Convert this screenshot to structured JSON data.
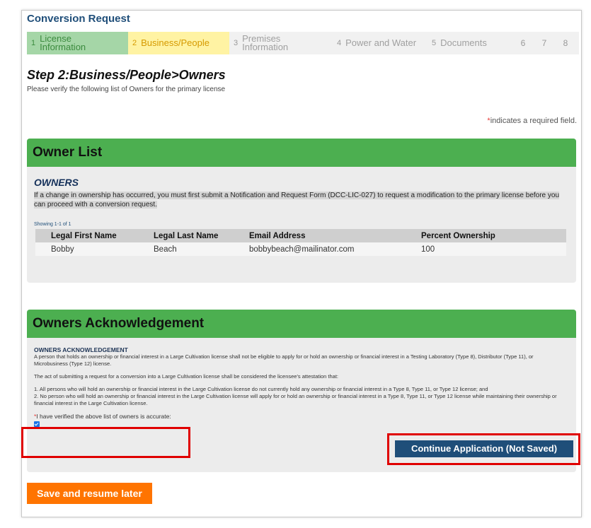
{
  "header": {
    "title": "Conversion Request"
  },
  "steps": [
    {
      "num": "1",
      "label": "License Information",
      "line1": "License",
      "line2": "Information",
      "state": "complete"
    },
    {
      "num": "2",
      "label": "Business/People",
      "state": "current"
    },
    {
      "num": "3",
      "label": "Premises Information",
      "line1": "Premises",
      "line2": "Information",
      "state": "pending"
    },
    {
      "num": "4",
      "label": "Power and Water",
      "state": "pending"
    },
    {
      "num": "5",
      "label": "Documents",
      "state": "pending"
    },
    {
      "num": "6",
      "state": "pending"
    },
    {
      "num": "7",
      "state": "pending"
    },
    {
      "num": "8",
      "state": "pending"
    }
  ],
  "step_heading": "Step 2:Business/People>Owners",
  "step_sub": "Please verify the following list of Owners for the primary license",
  "required_note": {
    "star": "*",
    "text": "indicates a required field."
  },
  "owner_list": {
    "header": "Owner List",
    "title": "OWNERS",
    "description": "If a change in ownership has occurred, you must first submit a Notification and Request Form (DCC-LIC-027) to request a modification to the primary license before you can proceed with a conversion request.",
    "showing": "Showing 1-1 of 1",
    "columns": [
      "Legal First Name",
      "Legal Last Name",
      "Email Address",
      "Percent Ownership"
    ],
    "rows": [
      [
        "Bobby",
        "Beach",
        "bobbybeach@mailinator.com",
        "100"
      ]
    ]
  },
  "acknowledgement": {
    "header": "Owners Acknowledgement",
    "title": "OWNERS ACKNOWLEDGEMENT",
    "para1": "A person that holds an ownership or financial interest in a Large Cultivation license shall not be eligible to apply for or hold an ownership or financial interest in a Testing Laboratory (Type 8), Distributor (Type 11), or Microbusiness (Type 12) license.",
    "para2": "The act of submitting a request for a conversion into a Large Cultivation license shall be considered the licensee's attestation that:",
    "item1": "1. All persons who will hold an ownership or financial interest in the Large Cultivation license do not currently hold any ownership or financial interest in a Type 8, Type 11, or Type 12 license; and",
    "item2": "2. No person who will hold an ownership or financial interest in the Large Cultivation license will apply for or hold an ownership or financial interest in a Type 8, Type 11, or Type 12 license while maintaining their ownership or financial interest in the Large Cultivation license.",
    "verify_star": "*",
    "verify_label": "I have verified the above list of owners is accurate:",
    "verify_checked": true
  },
  "buttons": {
    "save": "Save and resume later",
    "continue": "Continue Application (Not Saved)"
  },
  "colors": {
    "section_header": "#4caf50",
    "step_complete": "#a5d6a7",
    "step_current": "#fff3a3",
    "save_button": "#ff7400",
    "continue_button": "#1f4e79",
    "highlight_box": "#e00000"
  }
}
